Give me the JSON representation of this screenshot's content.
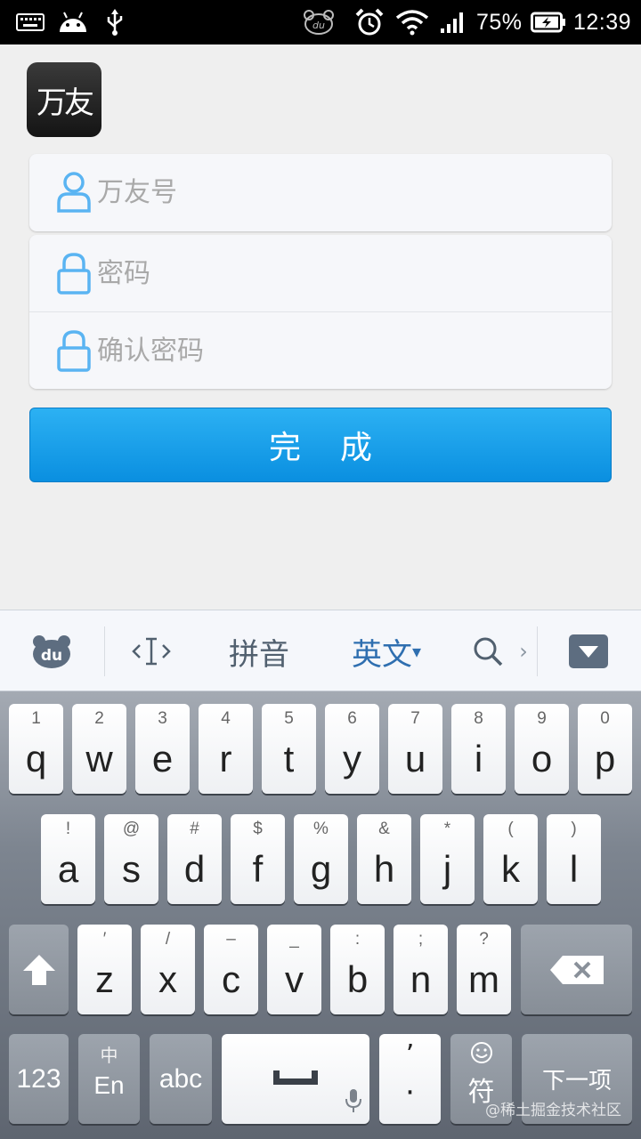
{
  "status_bar": {
    "battery": "75%",
    "time": "12:39"
  },
  "app": {
    "logo_text": "万友"
  },
  "form": {
    "account_placeholder": "万友号",
    "password_placeholder": "密码",
    "confirm_placeholder": "确认密码",
    "submit_label": "完成"
  },
  "ime_toolbar": {
    "pinyin": "拼音",
    "english": "英文",
    "english_caret": "▾",
    "more": "›"
  },
  "keyboard": {
    "row1": [
      {
        "main": "q",
        "sub": "1"
      },
      {
        "main": "w",
        "sub": "2"
      },
      {
        "main": "e",
        "sub": "3"
      },
      {
        "main": "r",
        "sub": "4"
      },
      {
        "main": "t",
        "sub": "5"
      },
      {
        "main": "y",
        "sub": "6"
      },
      {
        "main": "u",
        "sub": "7"
      },
      {
        "main": "i",
        "sub": "8"
      },
      {
        "main": "o",
        "sub": "9"
      },
      {
        "main": "p",
        "sub": "0"
      }
    ],
    "row2": [
      {
        "main": "a",
        "sub": "!"
      },
      {
        "main": "s",
        "sub": "@"
      },
      {
        "main": "d",
        "sub": "#"
      },
      {
        "main": "f",
        "sub": "$"
      },
      {
        "main": "g",
        "sub": "%"
      },
      {
        "main": "h",
        "sub": "&"
      },
      {
        "main": "j",
        "sub": "*"
      },
      {
        "main": "k",
        "sub": "("
      },
      {
        "main": "l",
        "sub": ")"
      }
    ],
    "row3": [
      {
        "main": "z",
        "sub": "′"
      },
      {
        "main": "x",
        "sub": "/"
      },
      {
        "main": "c",
        "sub": "–"
      },
      {
        "main": "v",
        "sub": "_"
      },
      {
        "main": "b",
        "sub": ":"
      },
      {
        "main": "n",
        "sub": ";"
      },
      {
        "main": "m",
        "sub": "?"
      }
    ],
    "numbers_key": "123",
    "lang_key_top": "中",
    "lang_key_bottom": "En",
    "abc_key": "abc",
    "punct_top": "’",
    "punct_bottom": "·",
    "symbols_key": "符",
    "next_key": "下一项"
  },
  "watermark": "@稀土掘金技术社区",
  "colors": {
    "accent": "#1a9fea",
    "field_icon": "#5ab4f2"
  }
}
